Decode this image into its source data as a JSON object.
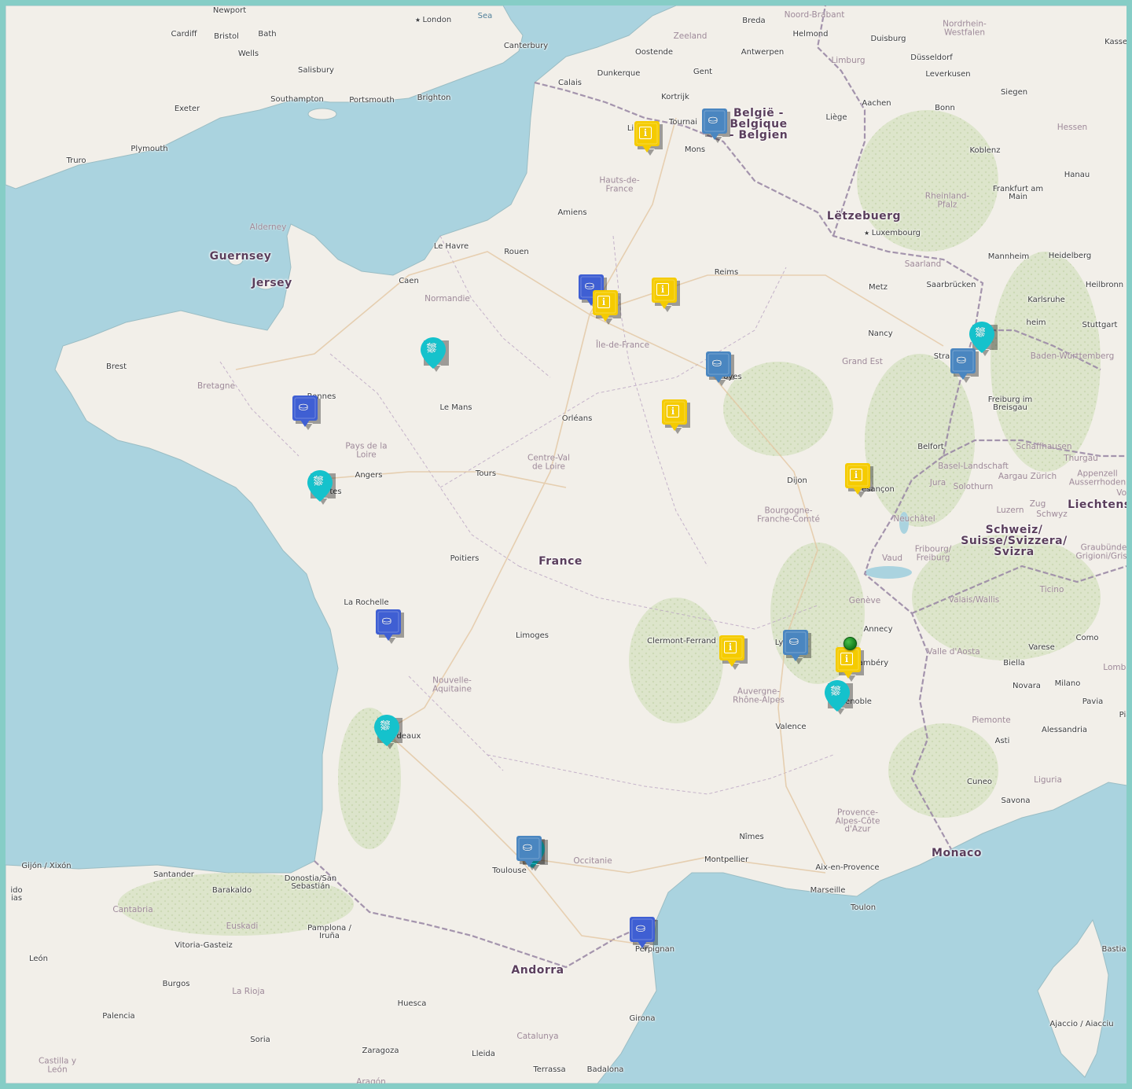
{
  "map": {
    "colors": {
      "sea": "#aad3df",
      "land": "#f2efe9",
      "border": "#86cdc6",
      "pin_info": "#f5cb00",
      "pin_shop_dark": "#3f5fd3",
      "pin_shop": "#4a86c0",
      "pin_shower": "#15c2cc",
      "current_location": "#2e9e35"
    },
    "countries": [
      {
        "id": "belgium",
        "text": "België -\nBelgique\n- Belgien"
      },
      {
        "id": "france",
        "text": "France"
      },
      {
        "id": "luxembourg",
        "text": "Lëtzebuerg"
      },
      {
        "id": "switzerland",
        "text": "Schweiz/\nSuisse/Svizzera/\nSvizra"
      },
      {
        "id": "liechtenstein",
        "text": "Liechtenst"
      },
      {
        "id": "andorra",
        "text": "Andorra"
      },
      {
        "id": "monaco",
        "text": "Monaco"
      },
      {
        "id": "guernsey",
        "text": "Guernsey"
      },
      {
        "id": "jersey",
        "text": "Jersey"
      }
    ],
    "regions": [
      {
        "id": "hauts-de-france",
        "text": "Hauts-de-\nFrance"
      },
      {
        "id": "normandie",
        "text": "Normandie"
      },
      {
        "id": "bretagne",
        "text": "Bretagne"
      },
      {
        "id": "pays-de-la-loire",
        "text": "Pays de la\nLoire"
      },
      {
        "id": "ile-de-france",
        "text": "Île-de-France"
      },
      {
        "id": "grand-est",
        "text": "Grand Est"
      },
      {
        "id": "centre-val-de-loire",
        "text": "Centre-Val\nde Loire"
      },
      {
        "id": "bourgogne",
        "text": "Bourgogne-\nFranche-Comté"
      },
      {
        "id": "nouvelle-aquitaine",
        "text": "Nouvelle-\nAquitaine"
      },
      {
        "id": "auvergne",
        "text": "Auvergne-\nRhône-Alpes"
      },
      {
        "id": "occitanie",
        "text": "Occitanie"
      },
      {
        "id": "paca",
        "text": "Provence-\nAlpes-Côte\nd'Azur"
      },
      {
        "id": "cantabria",
        "text": "Cantabria"
      },
      {
        "id": "euskadi",
        "text": "Euskadi"
      },
      {
        "id": "la-rioja",
        "text": "La Rioja"
      },
      {
        "id": "catalunya",
        "text": "Catalunya"
      },
      {
        "id": "aragon",
        "text": "Aragón"
      },
      {
        "id": "castilla",
        "text": "Castilla y\nLeón"
      },
      {
        "id": "zeeland",
        "text": "Zeeland"
      },
      {
        "id": "noord-brabant",
        "text": "Noord-Brabant"
      },
      {
        "id": "limburg",
        "text": "Limburg"
      },
      {
        "id": "nordrhein",
        "text": "Nordrhein-\nWestfalen"
      },
      {
        "id": "hessen",
        "text": "Hessen"
      },
      {
        "id": "rheinland",
        "text": "Rheinland-\nPfalz"
      },
      {
        "id": "saarland",
        "text": "Saarland"
      },
      {
        "id": "baden",
        "text": "Baden-Württemberg"
      },
      {
        "id": "schaffhausen",
        "text": "Schaffhausen"
      },
      {
        "id": "thurgau",
        "text": "Thurgau"
      },
      {
        "id": "basel",
        "text": "Basel-Landschaft"
      },
      {
        "id": "aargau",
        "text": "Aargau Zürich"
      },
      {
        "id": "appenzell",
        "text": "Appenzell\nAusserrhoden"
      },
      {
        "id": "jura",
        "text": "Jura"
      },
      {
        "id": "solothurn",
        "text": "Solothurn"
      },
      {
        "id": "luzern",
        "text": "Luzern"
      },
      {
        "id": "zug",
        "text": "Zug"
      },
      {
        "id": "schwyz",
        "text": "Schwyz"
      },
      {
        "id": "vorarl",
        "text": "Vora"
      },
      {
        "id": "neuchatel",
        "text": "Neuchâtel"
      },
      {
        "id": "fribourg",
        "text": "Fribourg/\nFreiburg"
      },
      {
        "id": "vaud",
        "text": "Vaud"
      },
      {
        "id": "valais",
        "text": "Valais/Wallis"
      },
      {
        "id": "geneve",
        "text": "Genève"
      },
      {
        "id": "ticino",
        "text": "Ticino"
      },
      {
        "id": "graubunden",
        "text": "Graubünde\nGrigioni/Grisc"
      },
      {
        "id": "valle-aosta",
        "text": "Valle d'Aosta"
      },
      {
        "id": "piemonte",
        "text": "Piemonte"
      },
      {
        "id": "liguria",
        "text": "Liguria"
      },
      {
        "id": "lombardia",
        "text": "Lomba"
      },
      {
        "id": "alderney",
        "text": "Alderney"
      }
    ],
    "cities": [
      {
        "id": "london",
        "text": "London",
        "cap": true
      },
      {
        "id": "newport",
        "text": "Newport"
      },
      {
        "id": "cardiff",
        "text": "Cardiff"
      },
      {
        "id": "bristol",
        "text": "Bristol"
      },
      {
        "id": "bath",
        "text": "Bath"
      },
      {
        "id": "wells",
        "text": "Wells"
      },
      {
        "id": "salisbury",
        "text": "Salisbury"
      },
      {
        "id": "exeter",
        "text": "Exeter"
      },
      {
        "id": "southampton",
        "text": "Southampton"
      },
      {
        "id": "portsmouth",
        "text": "Portsmouth"
      },
      {
        "id": "brighton",
        "text": "Brighton"
      },
      {
        "id": "canterbury",
        "text": "Canterbury"
      },
      {
        "id": "plymouth",
        "text": "Plymouth"
      },
      {
        "id": "truro",
        "text": "Truro"
      },
      {
        "id": "calais",
        "text": "Calais"
      },
      {
        "id": "dunkerque",
        "text": "Dunkerque"
      },
      {
        "id": "oostende",
        "text": "Oostende"
      },
      {
        "id": "breda",
        "text": "Breda"
      },
      {
        "id": "antwerpen",
        "text": "Antwerpen"
      },
      {
        "id": "helmond",
        "text": "Helmond"
      },
      {
        "id": "gent",
        "text": "Gent"
      },
      {
        "id": "kortrijk",
        "text": "Kortrijk"
      },
      {
        "id": "tournai",
        "text": "Tournai"
      },
      {
        "id": "mons",
        "text": "Mons"
      },
      {
        "id": "lille",
        "text": "Li"
      },
      {
        "id": "liege",
        "text": "Liège"
      },
      {
        "id": "aachen",
        "text": "Aachen"
      },
      {
        "id": "duisburg",
        "text": "Duisburg"
      },
      {
        "id": "dusseldorf",
        "text": "Düsseldorf"
      },
      {
        "id": "leverkusen",
        "text": "Leverkusen"
      },
      {
        "id": "bonn",
        "text": "Bonn"
      },
      {
        "id": "siegen",
        "text": "Siegen"
      },
      {
        "id": "kassel",
        "text": "Kassel"
      },
      {
        "id": "koblenz",
        "text": "Koblenz"
      },
      {
        "id": "hanau",
        "text": "Hanau"
      },
      {
        "id": "frankfurt",
        "text": "Frankfurt am\nMain"
      },
      {
        "id": "luxembourg-city",
        "text": "Luxembourg",
        "cap": true
      },
      {
        "id": "mannheim",
        "text": "Mannheim"
      },
      {
        "id": "heidelberg",
        "text": "Heidelberg"
      },
      {
        "id": "heilbronn",
        "text": "Heilbronn"
      },
      {
        "id": "karlsruhe",
        "text": "Karlsruhe"
      },
      {
        "id": "pforzheim",
        "text": "heim"
      },
      {
        "id": "stuttgart",
        "text": "Stuttgart"
      },
      {
        "id": "saarbrucken",
        "text": "Saarbrücken"
      },
      {
        "id": "metz",
        "text": "Metz"
      },
      {
        "id": "nancy",
        "text": "Nancy"
      },
      {
        "id": "strasbourg",
        "text": "Stra"
      },
      {
        "id": "freiburg",
        "text": "Freiburg im\nBreisgau"
      },
      {
        "id": "belfort",
        "text": "Belfort"
      },
      {
        "id": "amiens",
        "text": "Amiens"
      },
      {
        "id": "reims",
        "text": "Reims"
      },
      {
        "id": "le-havre",
        "text": "Le Havre"
      },
      {
        "id": "rouen",
        "text": "Rouen"
      },
      {
        "id": "caen",
        "text": "Caen"
      },
      {
        "id": "brest",
        "text": "Brest"
      },
      {
        "id": "rennes",
        "text": "Rennes"
      },
      {
        "id": "le-mans",
        "text": "Le Mans"
      },
      {
        "id": "orleans",
        "text": "Orléans"
      },
      {
        "id": "troyes",
        "text": "oyes"
      },
      {
        "id": "angers",
        "text": "Angers"
      },
      {
        "id": "nantes",
        "text": "tes"
      },
      {
        "id": "tours",
        "text": "Tours"
      },
      {
        "id": "dijon",
        "text": "Dijon"
      },
      {
        "id": "besancon",
        "text": "esançon"
      },
      {
        "id": "poitiers",
        "text": "Poitiers"
      },
      {
        "id": "la-rochelle",
        "text": "La Rochelle"
      },
      {
        "id": "limoges",
        "text": "Limoges"
      },
      {
        "id": "clermont",
        "text": "Clermont-Ferrand"
      },
      {
        "id": "lyon",
        "text": "Ly"
      },
      {
        "id": "annecy",
        "text": "Annecy"
      },
      {
        "id": "chambery",
        "text": "ambéry"
      },
      {
        "id": "grenoble",
        "text": "enoble"
      },
      {
        "id": "valence",
        "text": "Valence"
      },
      {
        "id": "bordeaux",
        "text": "rdeaux"
      },
      {
        "id": "toulouse",
        "text": "Toulouse"
      },
      {
        "id": "nimes",
        "text": "Nîmes"
      },
      {
        "id": "montpellier",
        "text": "Montpellier"
      },
      {
        "id": "aix",
        "text": "Aix-en-Provence"
      },
      {
        "id": "marseille",
        "text": "Marseille"
      },
      {
        "id": "toulon",
        "text": "Toulon"
      },
      {
        "id": "perpignan",
        "text": "Perpignan"
      },
      {
        "id": "varese",
        "text": "Varese"
      },
      {
        "id": "como",
        "text": "Como"
      },
      {
        "id": "biella",
        "text": "Biella"
      },
      {
        "id": "novara",
        "text": "Novara"
      },
      {
        "id": "milano",
        "text": "Milano"
      },
      {
        "id": "pavia",
        "text": "Pavia"
      },
      {
        "id": "asti",
        "text": "Asti"
      },
      {
        "id": "alessandria",
        "text": "Alessandria"
      },
      {
        "id": "cuneo",
        "text": "Cuneo"
      },
      {
        "id": "savona",
        "text": "Savona"
      },
      {
        "id": "piacenza",
        "text": "Pia"
      },
      {
        "id": "bastia",
        "text": "Bastia"
      },
      {
        "id": "ajaccio",
        "text": "Ajaccio / Aiacciu"
      },
      {
        "id": "gijon",
        "text": "Gijón / Xixón"
      },
      {
        "id": "oviedo",
        "text": "ido\nias"
      },
      {
        "id": "santander",
        "text": "Santander"
      },
      {
        "id": "barakaldo",
        "text": "Barakaldo"
      },
      {
        "id": "donostia",
        "text": "Donostia/San\nSebastián"
      },
      {
        "id": "pamplona",
        "text": "Pamplona /\nIruña"
      },
      {
        "id": "vitoria",
        "text": "Vitoria-Gasteiz"
      },
      {
        "id": "leon",
        "text": "León"
      },
      {
        "id": "burgos",
        "text": "Burgos"
      },
      {
        "id": "palencia",
        "text": "Palencia"
      },
      {
        "id": "soria",
        "text": "Soria"
      },
      {
        "id": "zaragoza",
        "text": "Zaragoza"
      },
      {
        "id": "huesca",
        "text": "Huesca"
      },
      {
        "id": "lleida",
        "text": "Lleida"
      },
      {
        "id": "girona",
        "text": "Girona"
      },
      {
        "id": "terrassa",
        "text": "Terrassa"
      },
      {
        "id": "badalona",
        "text": "Badalona"
      }
    ],
    "water": [
      {
        "id": "north-sea",
        "text": "Sea"
      }
    ],
    "markers": [
      {
        "id": "lille",
        "kind": "info"
      },
      {
        "id": "tournai",
        "kind": "shop"
      },
      {
        "id": "paris-a",
        "kind": "shop-dark"
      },
      {
        "id": "paris-b",
        "kind": "info"
      },
      {
        "id": "reims-area",
        "kind": "info"
      },
      {
        "id": "le-mans-area",
        "kind": "shower"
      },
      {
        "id": "troyes",
        "kind": "shop"
      },
      {
        "id": "rennes",
        "kind": "shop-dark"
      },
      {
        "id": "auxerre-area",
        "kind": "info"
      },
      {
        "id": "strasbourg-a",
        "kind": "shower"
      },
      {
        "id": "strasbourg-b",
        "kind": "shop"
      },
      {
        "id": "nantes",
        "kind": "shower"
      },
      {
        "id": "besancon",
        "kind": "info"
      },
      {
        "id": "la-rochelle",
        "kind": "shop-dark"
      },
      {
        "id": "clermont",
        "kind": "info"
      },
      {
        "id": "lyon",
        "kind": "shop"
      },
      {
        "id": "chambery",
        "kind": "info"
      },
      {
        "id": "grenoble",
        "kind": "shower"
      },
      {
        "id": "bordeaux",
        "kind": "shower"
      },
      {
        "id": "toulouse-a",
        "kind": "shower"
      },
      {
        "id": "toulouse-b",
        "kind": "shop"
      },
      {
        "id": "perpignan",
        "kind": "shop-dark"
      }
    ],
    "current_location": {
      "id": "annecy-south"
    }
  }
}
